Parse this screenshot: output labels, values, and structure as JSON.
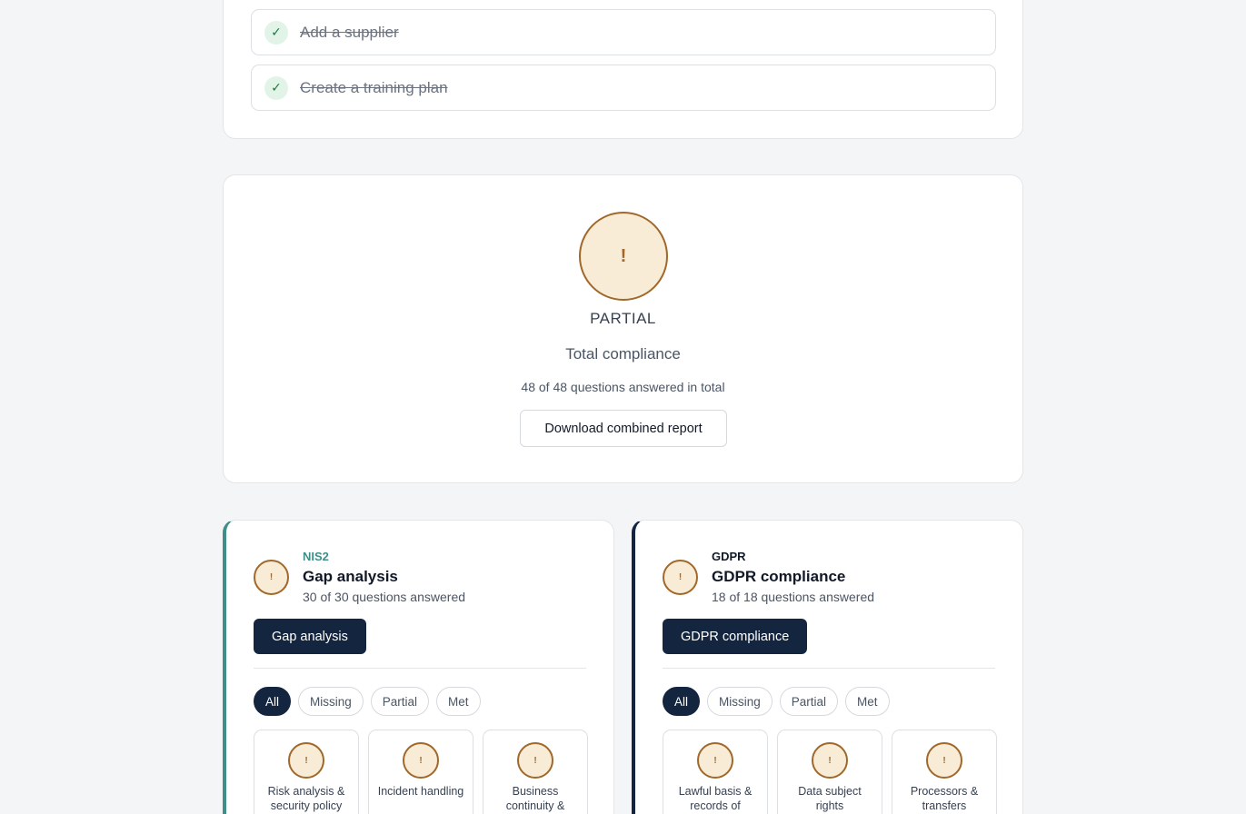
{
  "checklist": {
    "items": [
      {
        "icon": "checkmark-icon",
        "glyph": "✓",
        "label": "Add a supplier",
        "done": true
      },
      {
        "icon": "checkmark-icon",
        "glyph": "✓",
        "label": "Create a training plan",
        "done": true
      }
    ]
  },
  "total": {
    "status_glyph": "!",
    "status": "PARTIAL",
    "title": "Total compliance",
    "answered": "48 of 48 questions answered in total",
    "download_label": "Download combined report"
  },
  "frameworks": [
    {
      "accent": "#3f8f88",
      "tag": "NIS2",
      "status_glyph": "!",
      "title": "Gap analysis",
      "answered": "30 of 30 questions answered",
      "button_label": "Gap analysis",
      "filters": [
        "All",
        "Missing",
        "Partial",
        "Met"
      ],
      "active_filter": "All",
      "tiles": [
        {
          "glyph": "!",
          "label": "Risk analysis & security policy"
        },
        {
          "glyph": "!",
          "label": "Incident handling"
        },
        {
          "glyph": "!",
          "label": "Business continuity &"
        }
      ]
    },
    {
      "accent": "#14253f",
      "tag": "GDPR",
      "status_glyph": "!",
      "title": "GDPR compliance",
      "answered": "18 of 18 questions answered",
      "button_label": "GDPR compliance",
      "filters": [
        "All",
        "Missing",
        "Partial",
        "Met"
      ],
      "active_filter": "All",
      "tiles": [
        {
          "glyph": "!",
          "label": "Lawful basis & records of"
        },
        {
          "glyph": "!",
          "label": "Data subject rights"
        },
        {
          "glyph": "!",
          "label": "Processors & transfers"
        }
      ]
    }
  ],
  "colors": {
    "partial_border": "#a0682a",
    "partial_fill": "#f8ecd6",
    "done_fill": "#e2f4e8",
    "done_mark": "#1e7a45",
    "primary": "#14253f"
  }
}
